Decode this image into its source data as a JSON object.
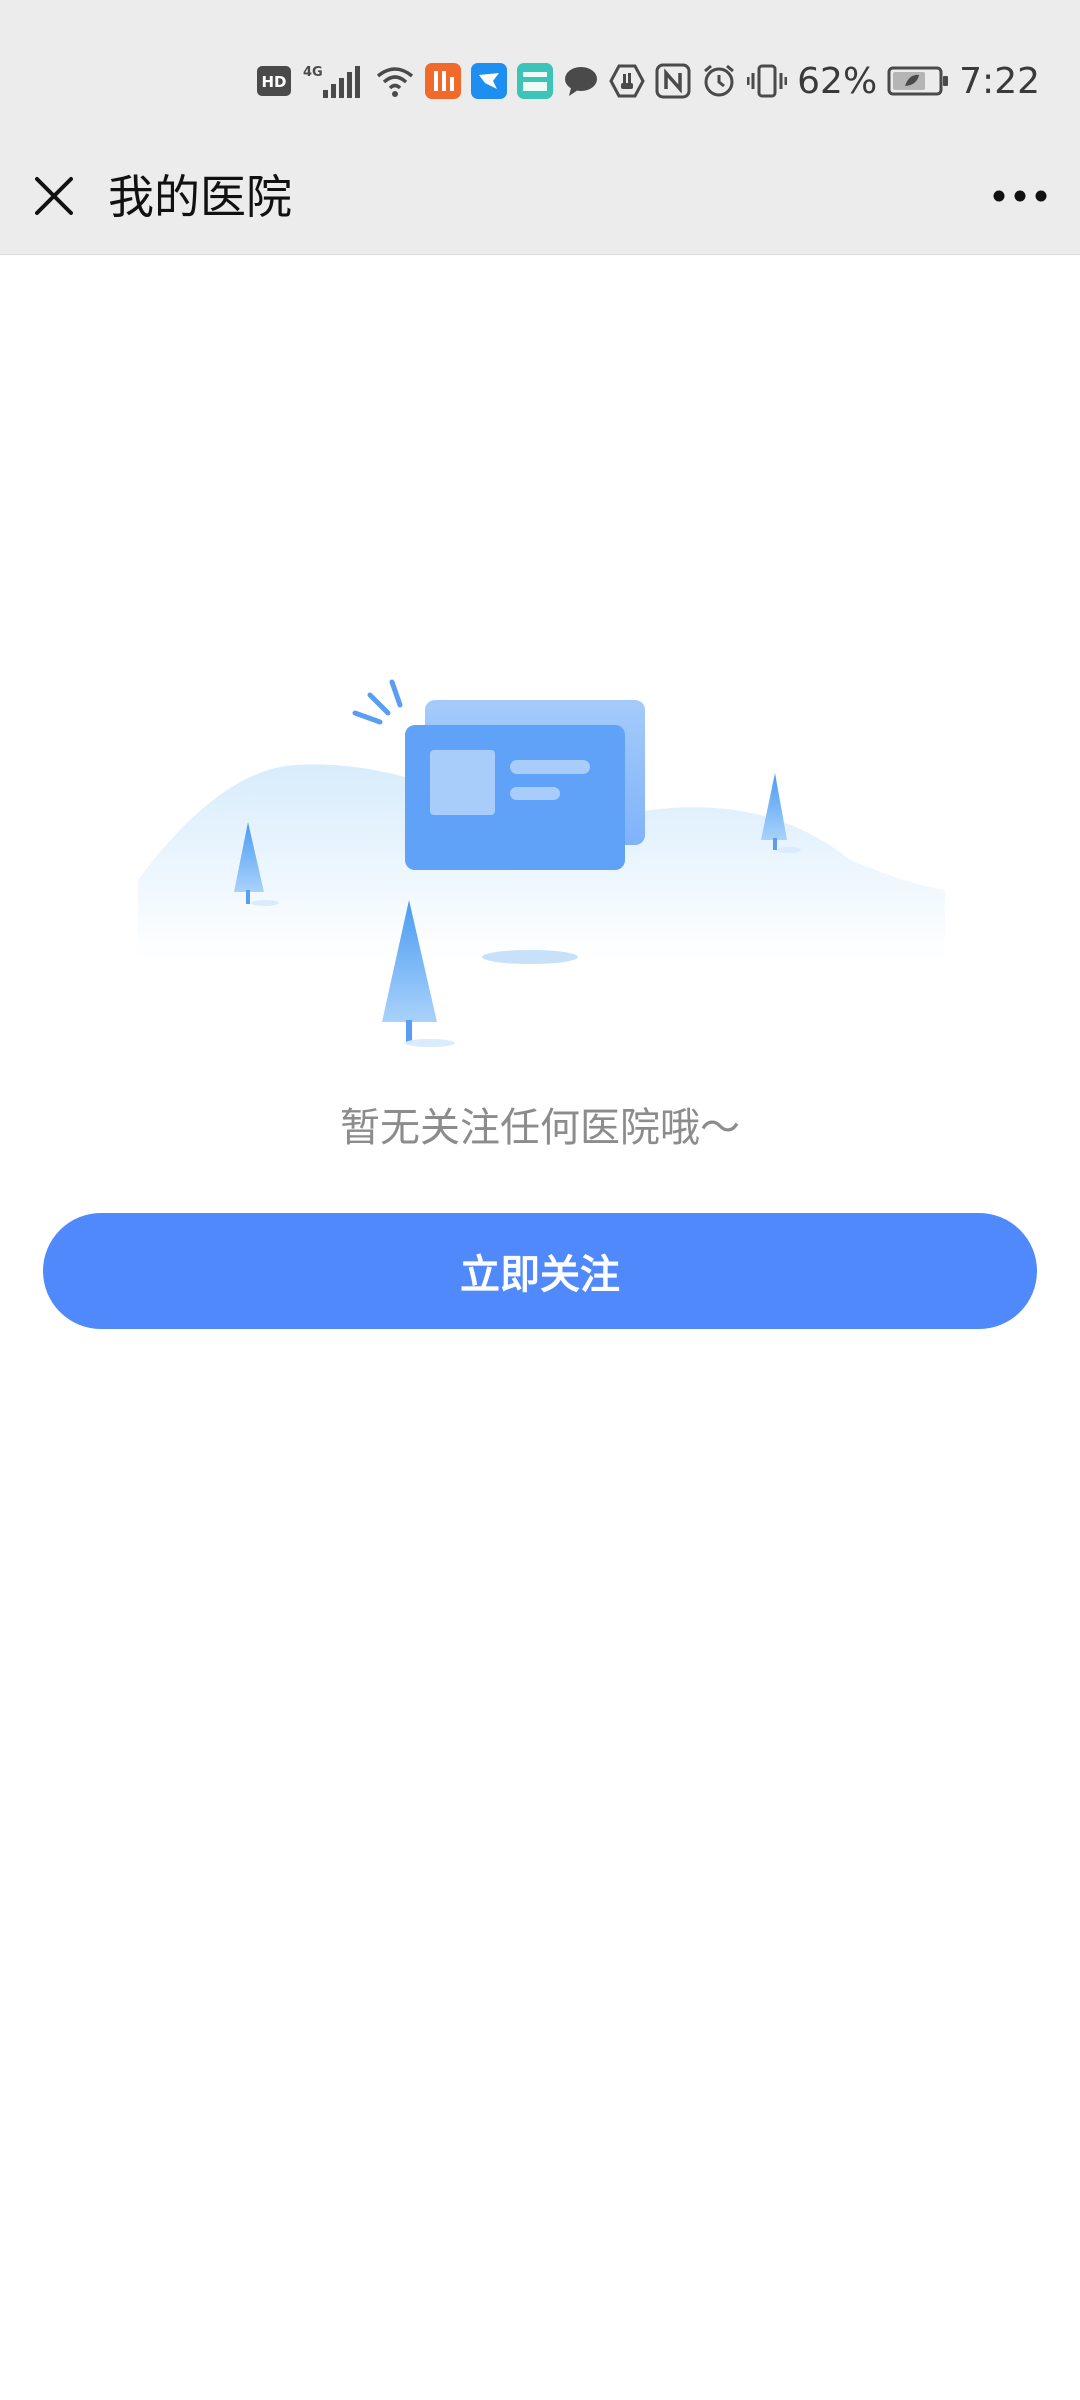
{
  "status_bar": {
    "hd_label": "HD",
    "network_label": "4G",
    "battery_percent": "62%",
    "time": "7:22",
    "icons": [
      "hd-icon",
      "signal-icon",
      "wifi-icon",
      "app-icon-orange",
      "app-icon-blue",
      "boss-app-icon",
      "message-icon",
      "shield-hand-icon",
      "nfc-icon",
      "alarm-icon",
      "vibrate-icon",
      "battery-icon"
    ]
  },
  "nav": {
    "title": "我的医院",
    "close_icon": "close-icon",
    "more_icon": "more-icon"
  },
  "main": {
    "empty_message": "暂无关注任何医院哦～",
    "follow_button_label": "立即关注",
    "illustration": "empty-card-illustration"
  },
  "colors": {
    "accent": "#4f89fb",
    "status_bar_bg": "#ececec",
    "empty_text": "#8c8c8c"
  }
}
